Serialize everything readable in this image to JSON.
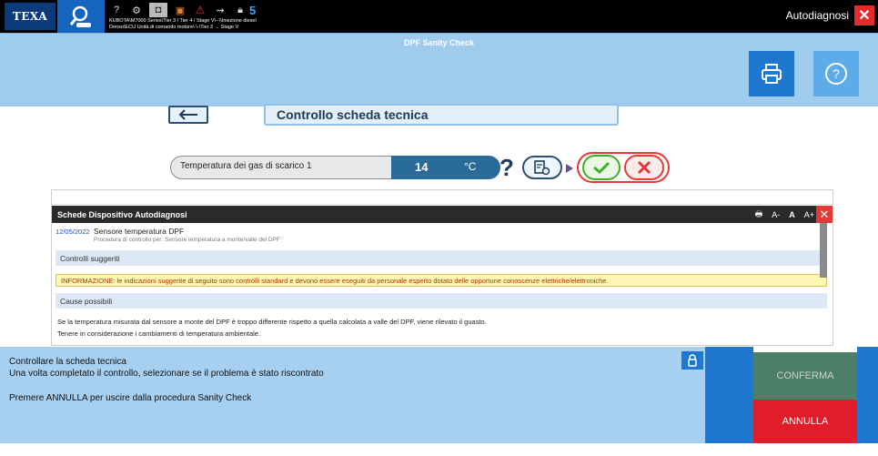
{
  "topbar": {
    "logo": "TEXA",
    "notification_count": "5",
    "path_line1": "KUBOTA\\M7000 Series\\Tier 3 / Tier 4 / Stage V\\--\\\\Iniezione diesel",
    "path_line2": "Denso\\ECU Unità di comando motore\\-\\-\\Tier 3 → Stage V",
    "right_label": "Autodiagnosi"
  },
  "header": {
    "title": "DPF Sanity Check"
  },
  "main": {
    "section_title": "Controllo scheda tecnica",
    "parameter_label": "Temperatura dei gas di scarico 1",
    "parameter_value": "14",
    "parameter_unit": "°C"
  },
  "panel": {
    "header": "Schede Dispositivo Autodiagnosi",
    "tool_font_minus": "A-",
    "tool_font": "A",
    "tool_font_plus": "A+",
    "entry_date": "12/05/2022",
    "entry_title": "Sensore temperatura DPF",
    "entry_subtitle": "Procedura di controllo per: Sensore temperatura a monte/valle del DPF",
    "section_suggested": "Controlli suggeriti",
    "info_text": "INFORMAZIONE: le indicazioni suggerite di seguito sono controlli standard e devono essere eseguiti da personale esperto dotato delle opportune conoscenze elettriche/elettroniche.",
    "section_causes": "Cause possibili",
    "cause_line1": "Se la temperatura misurata dal sensore a monte del DPF è troppo differente rispetto a quella calcolata a valle del DPF, viene rilevato il guasto.",
    "cause_line2": "Tenere in considerazione i cambiamenti di temperatura ambientale."
  },
  "bottom": {
    "message_line1": "Controllare la scheda tecnica",
    "message_line2": "Una volta completato il controllo, selezionare se il problema è stato riscontrato",
    "message_line3": "Premere ANNULLA per uscire dalla procedura Sanity Check",
    "confirm_label": "CONFERMA",
    "cancel_label": "ANNULLA"
  },
  "colors": {
    "accent_blue": "#1e78d0",
    "header_light_blue": "#9fcbed",
    "confirm_green": "#4c7f68",
    "cancel_red": "#e11d2a"
  },
  "icons": [
    "search-icon",
    "help-circle-icon",
    "gear-link-icon",
    "camera-icon",
    "vehicle-icon",
    "warning-icon",
    "usb-icon",
    "lock-icon",
    "close-icon",
    "print-icon",
    "question-icon",
    "back-arrow-icon",
    "doc-settings-icon",
    "check-icon",
    "cancel-x-icon"
  ]
}
